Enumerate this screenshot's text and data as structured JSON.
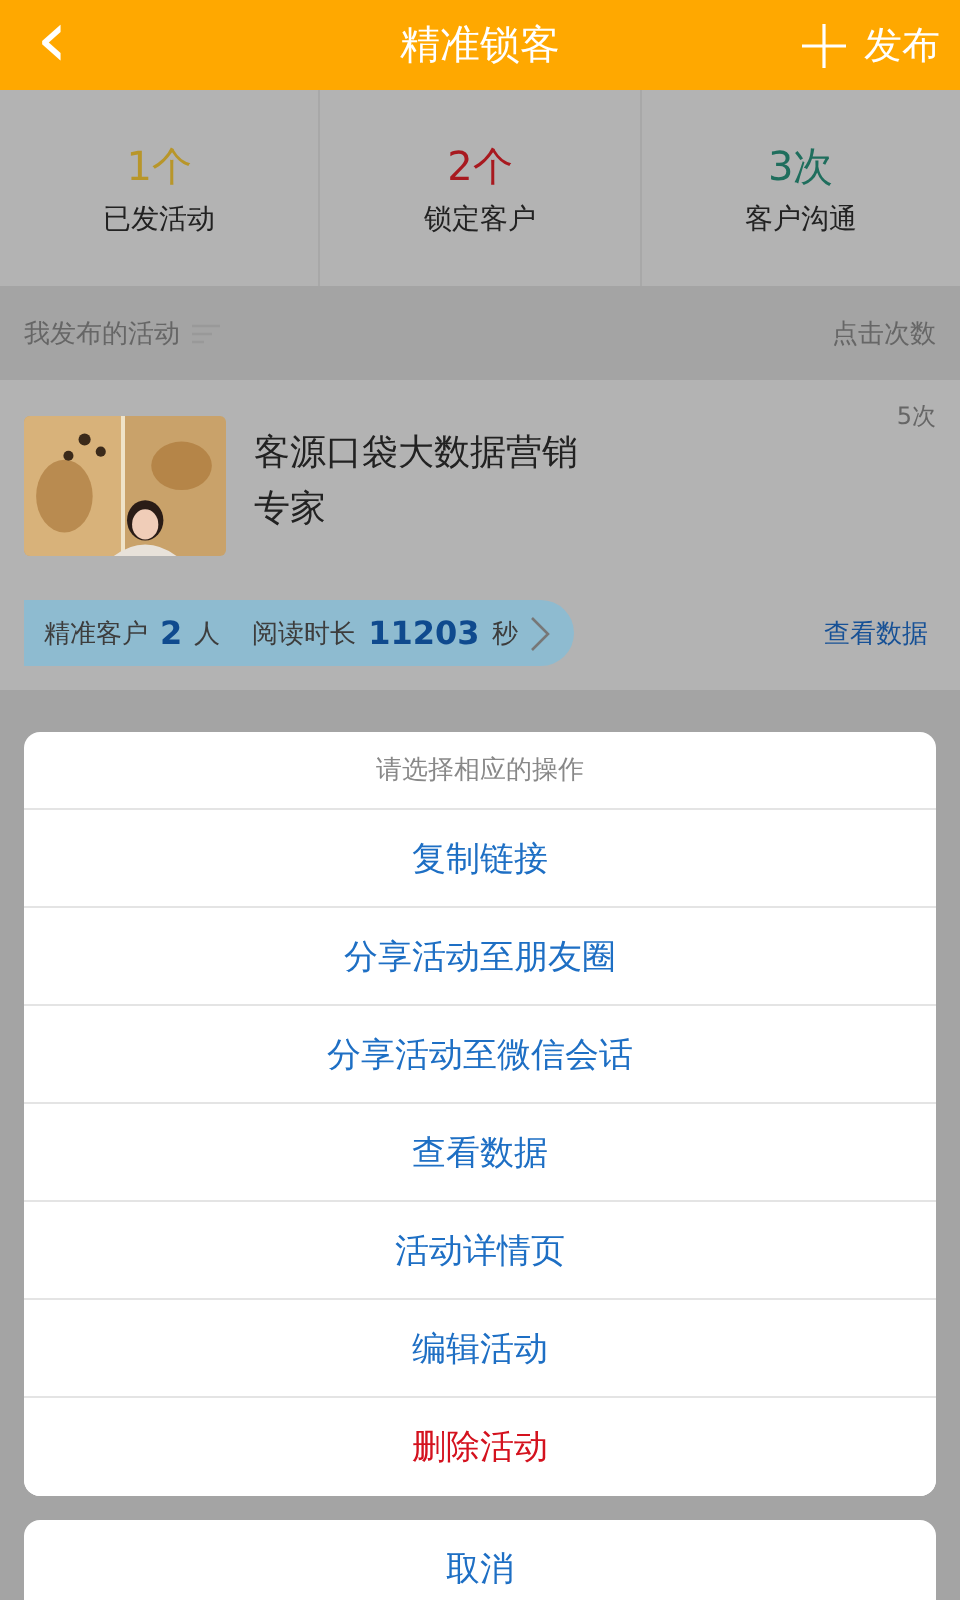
{
  "header": {
    "back_icon": "‹",
    "title": "精准锁客",
    "publish": "发布"
  },
  "stats": [
    {
      "value": "1个",
      "label": "已发活动",
      "color": "#b8962a"
    },
    {
      "value": "2个",
      "label": "锁定客户",
      "color": "#a8191f"
    },
    {
      "value": "3次",
      "label": "客户沟通",
      "color": "#1f6e5d"
    }
  ],
  "section": {
    "title": "我发布的活动",
    "right": "点击次数"
  },
  "activity": {
    "title": "客源口袋大数据营销专家",
    "clicks": "5次",
    "precise_label": "精准客户",
    "precise_value": "2",
    "precise_unit": "人",
    "read_label": "阅读时长",
    "read_value": "11203",
    "read_unit": "秒",
    "view_data": "查看数据"
  },
  "action_sheet": {
    "title": "请选择相应的操作",
    "items": [
      {
        "label": "复制链接",
        "kind": "normal"
      },
      {
        "label": "分享活动至朋友圈",
        "kind": "normal"
      },
      {
        "label": "分享活动至微信会话",
        "kind": "normal"
      },
      {
        "label": "查看数据",
        "kind": "normal"
      },
      {
        "label": "活动详情页",
        "kind": "normal"
      },
      {
        "label": "编辑活动",
        "kind": "normal"
      },
      {
        "label": "删除活动",
        "kind": "destructive"
      }
    ],
    "cancel": "取消"
  }
}
